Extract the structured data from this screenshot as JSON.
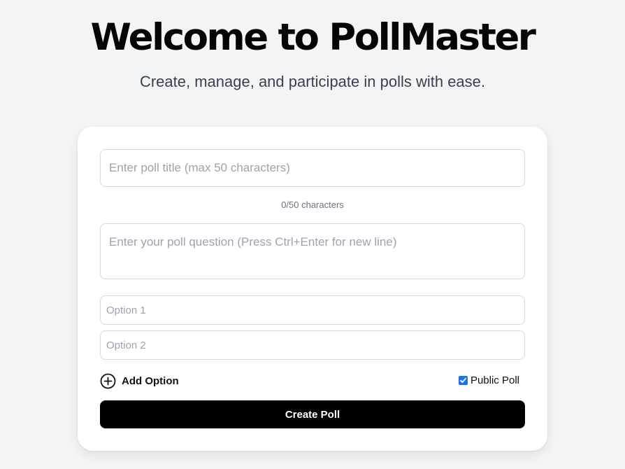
{
  "header": {
    "title": "Welcome to PollMaster",
    "subtitle": "Create, manage, and participate in polls with ease."
  },
  "form": {
    "title_input": {
      "value": "",
      "placeholder": "Enter poll title (max 50 characters)"
    },
    "char_count": "0/50 characters",
    "question_input": {
      "value": "",
      "placeholder": "Enter your poll question (Press Ctrl+Enter for new line)"
    },
    "options": [
      {
        "value": "",
        "placeholder": "Option 1"
      },
      {
        "value": "",
        "placeholder": "Option 2"
      }
    ],
    "add_option_label": "Add Option",
    "add_option_icon": "plus-circle-icon",
    "public_poll": {
      "label": "Public Poll",
      "checked": true
    },
    "submit_label": "Create Poll"
  },
  "colors": {
    "background": "#f3f4f6",
    "card": "#ffffff",
    "button": "#000000",
    "checkbox_accent": "#1a73e8",
    "placeholder": "#9ca3af"
  }
}
